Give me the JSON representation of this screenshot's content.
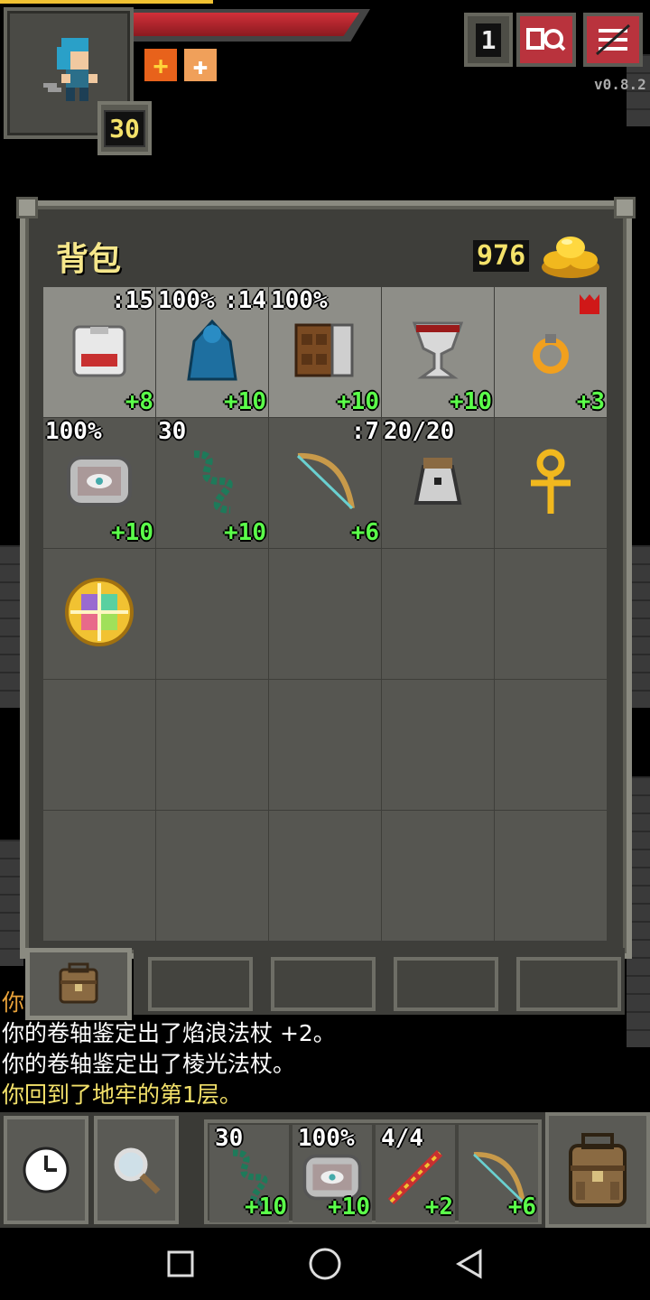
{
  "hud": {
    "hero_level": "30",
    "depth": "1",
    "version": "v0.8.2"
  },
  "inventory": {
    "title": "背包",
    "gold": "976",
    "slots": [
      {
        "name": "plate-armor-slot",
        "tl": "",
        "tr": ":15",
        "br": "+8",
        "icon": "chest-armor-icon",
        "bg": "light"
      },
      {
        "name": "cloak-slot",
        "tl": "100%",
        "tr": ":14",
        "br": "+10",
        "icon": "cloak-icon",
        "bg": "light"
      },
      {
        "name": "spellbook-slot",
        "tl": "100%",
        "tr": "",
        "br": "+10",
        "icon": "spellbook-icon",
        "bg": "light"
      },
      {
        "name": "chalice-slot",
        "tl": "",
        "tr": "",
        "br": "+10",
        "icon": "chalice-icon",
        "bg": "light"
      },
      {
        "name": "ring-slot",
        "tl": "",
        "tr": "",
        "br": "+3",
        "icon": "ring-icon",
        "bg": "light"
      },
      {
        "name": "horn-slot",
        "tl": "100%",
        "tr": "",
        "br": "+10",
        "icon": "horn-icon",
        "bg": "dark"
      },
      {
        "name": "whip-slot",
        "tl": "30",
        "tr": "",
        "br": "+10",
        "icon": "whip-icon",
        "bg": "dark"
      },
      {
        "name": "bow-slot",
        "tl": "",
        "tr": ":7",
        "br": "+6",
        "icon": "bow-icon",
        "bg": "dark"
      },
      {
        "name": "velvet-pouch-slot",
        "tl": "20/20",
        "tr": "",
        "br": "",
        "icon": "pouch-icon",
        "bg": "dark"
      },
      {
        "name": "ankh-slot",
        "tl": "",
        "tr": "",
        "br": "",
        "icon": "ankh-icon",
        "bg": "dark"
      },
      {
        "name": "trinket-slot",
        "tl": "",
        "tr": "",
        "br": "",
        "icon": "orb-icon",
        "bg": "dark"
      },
      {
        "name": "empty-slot",
        "tl": "",
        "tr": "",
        "br": "",
        "icon": "",
        "bg": "dark"
      },
      {
        "name": "empty-slot",
        "tl": "",
        "tr": "",
        "br": "",
        "icon": "",
        "bg": "dark"
      },
      {
        "name": "empty-slot",
        "tl": "",
        "tr": "",
        "br": "",
        "icon": "",
        "bg": "dark"
      },
      {
        "name": "empty-slot",
        "tl": "",
        "tr": "",
        "br": "",
        "icon": "",
        "bg": "dark"
      },
      {
        "name": "empty-slot",
        "tl": "",
        "tr": "",
        "br": "",
        "icon": "",
        "bg": "dark"
      },
      {
        "name": "empty-slot",
        "tl": "",
        "tr": "",
        "br": "",
        "icon": "",
        "bg": "dark"
      },
      {
        "name": "empty-slot",
        "tl": "",
        "tr": "",
        "br": "",
        "icon": "",
        "bg": "dark"
      },
      {
        "name": "empty-slot",
        "tl": "",
        "tr": "",
        "br": "",
        "icon": "",
        "bg": "dark"
      },
      {
        "name": "empty-slot",
        "tl": "",
        "tr": "",
        "br": "",
        "icon": "",
        "bg": "dark"
      },
      {
        "name": "empty-slot",
        "tl": "",
        "tr": "",
        "br": "",
        "icon": "",
        "bg": "dark"
      },
      {
        "name": "empty-slot",
        "tl": "",
        "tr": "",
        "br": "",
        "icon": "",
        "bg": "dark"
      },
      {
        "name": "empty-slot",
        "tl": "",
        "tr": "",
        "br": "",
        "icon": "",
        "bg": "dark"
      },
      {
        "name": "empty-slot",
        "tl": "",
        "tr": "",
        "br": "",
        "icon": "",
        "bg": "dark"
      },
      {
        "name": "empty-slot",
        "tl": "",
        "tr": "",
        "br": "",
        "icon": "",
        "bg": "dark"
      }
    ]
  },
  "log": {
    "partial": "你",
    "line1": "你的卷轴鉴定出了焰浪法杖 +2。",
    "line2": "你的卷轴鉴定出了棱光法杖。",
    "line3": "你回到了地牢的第1层。"
  },
  "quickslots": [
    {
      "name": "quickslot-whip",
      "tl": "30",
      "br": "+10",
      "icon": "whip-icon"
    },
    {
      "name": "quickslot-horn",
      "tl": "100%",
      "br": "+10",
      "icon": "horn-icon"
    },
    {
      "name": "quickslot-wand",
      "tl": "4/4",
      "br": "+2",
      "icon": "wand-icon"
    },
    {
      "name": "quickslot-bow",
      "tl": "",
      "br": "+6",
      "icon": "bow-icon"
    }
  ],
  "colors": {
    "accent_gold": "#f4e26a",
    "upgrade_green": "#5bff4a",
    "hp_red": "#d2303a",
    "panel": "#3e3e3a"
  }
}
